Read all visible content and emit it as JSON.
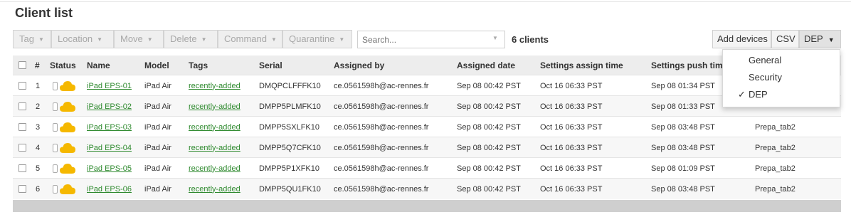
{
  "page": {
    "title": "Client list"
  },
  "toolbar": {
    "buttons": [
      {
        "label": "Tag"
      },
      {
        "label": "Location"
      },
      {
        "label": "Move"
      },
      {
        "label": "Delete"
      },
      {
        "label": "Command"
      },
      {
        "label": "Quarantine"
      }
    ],
    "search_placeholder": "Search...",
    "client_count": "6 clients",
    "add_devices_label": "Add devices",
    "csv_label": "CSV",
    "view_label": "DEP"
  },
  "table": {
    "columns": [
      "#",
      "Status",
      "Name",
      "Model",
      "Tags",
      "Serial",
      "Assigned by",
      "Assigned date",
      "Settings assign time",
      "Settings push tim"
    ],
    "rows": [
      {
        "num": "1",
        "name": "iPad EPS-01",
        "model": "iPad Air",
        "tag": "recently-added",
        "serial": "DMQPCLFFFK10",
        "assigned_by": "ce.0561598h@ac-rennes.fr",
        "assigned_date": "Sep 08 00:42 PST",
        "assign_time": "Oct 16 06:33 PST",
        "push_time": "Sep 08 01:34 PST",
        "profile": ""
      },
      {
        "num": "2",
        "name": "iPad EPS-02",
        "model": "iPad Air",
        "tag": "recently-added",
        "serial": "DMPP5PLMFK10",
        "assigned_by": "ce.0561598h@ac-rennes.fr",
        "assigned_date": "Sep 08 00:42 PST",
        "assign_time": "Oct 16 06:33 PST",
        "push_time": "Sep 08 01:33 PST",
        "profile": ""
      },
      {
        "num": "3",
        "name": "iPad EPS-03",
        "model": "iPad Air",
        "tag": "recently-added",
        "serial": "DMPP5SXLFK10",
        "assigned_by": "ce.0561598h@ac-rennes.fr",
        "assigned_date": "Sep 08 00:42 PST",
        "assign_time": "Oct 16 06:33 PST",
        "push_time": "Sep 08 03:48 PST",
        "profile": "Prepa_tab2"
      },
      {
        "num": "4",
        "name": "iPad EPS-04",
        "model": "iPad Air",
        "tag": "recently-added",
        "serial": "DMPP5Q7CFK10",
        "assigned_by": "ce.0561598h@ac-rennes.fr",
        "assigned_date": "Sep 08 00:42 PST",
        "assign_time": "Oct 16 06:33 PST",
        "push_time": "Sep 08 03:48 PST",
        "profile": "Prepa_tab2"
      },
      {
        "num": "5",
        "name": "iPad EPS-05",
        "model": "iPad Air",
        "tag": "recently-added",
        "serial": "DMPP5P1XFK10",
        "assigned_by": "ce.0561598h@ac-rennes.fr",
        "assigned_date": "Sep 08 00:42 PST",
        "assign_time": "Oct 16 06:33 PST",
        "push_time": "Sep 08 01:09 PST",
        "profile": "Prepa_tab2"
      },
      {
        "num": "6",
        "name": "iPad EPS-06",
        "model": "iPad Air",
        "tag": "recently-added",
        "serial": "DMPP5QU1FK10",
        "assigned_by": "ce.0561598h@ac-rennes.fr",
        "assigned_date": "Sep 08 00:42 PST",
        "assign_time": "Oct 16 06:33 PST",
        "push_time": "Sep 08 03:48 PST",
        "profile": "Prepa_tab2"
      }
    ]
  },
  "dropdown": {
    "items": [
      {
        "label": "General",
        "checked": false
      },
      {
        "label": "Security",
        "checked": false
      },
      {
        "label": "DEP",
        "checked": true
      }
    ],
    "check_mark": "✓"
  },
  "colors": {
    "link": "#2f8a2f",
    "cloud": "#f5b800",
    "header_bg": "#ededed"
  }
}
